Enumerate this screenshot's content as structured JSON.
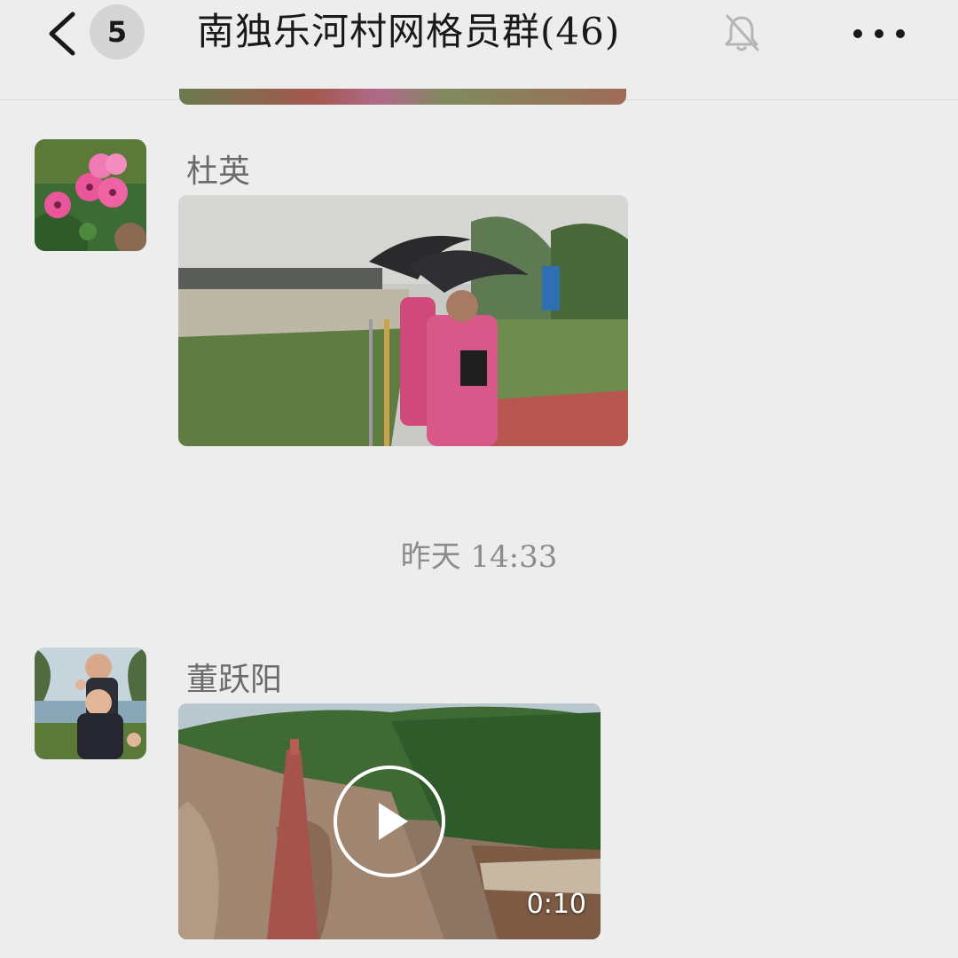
{
  "header": {
    "unread_count": "5",
    "title": "南独乐河村网格员群(46)",
    "back_icon": "chevron-left-icon",
    "mute_icon": "bell-off-icon",
    "more_icon": "more-horizontal-icon"
  },
  "messages": [
    {
      "sender": "杜英",
      "type": "image"
    },
    {
      "sender": "董跃阳",
      "type": "video",
      "duration": "0:10"
    }
  ],
  "divider": {
    "timestamp": "昨天 14:33"
  },
  "colors": {
    "background": "#ededed",
    "text": "#191919",
    "secondary_text": "#8c8c8c"
  }
}
